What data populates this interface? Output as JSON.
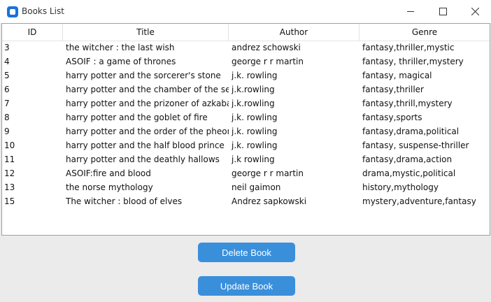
{
  "window": {
    "title": "Books List",
    "controls": {
      "minimize": "minimize-icon",
      "maximize": "maximize-icon",
      "close": "close-icon"
    }
  },
  "table": {
    "columns": [
      "ID",
      "Title",
      "Author",
      "Genre"
    ],
    "rows": [
      {
        "id": "3",
        "title": "the witcher : the last wish",
        "author": "andrez schowski",
        "genre": "fantasy,thriller,mystic"
      },
      {
        "id": "4",
        "title": "ASOIF : a game of thrones",
        "author": "george r r martin",
        "genre": "fantasy, thriller,mystery"
      },
      {
        "id": "5",
        "title": "harry potter and the sorcerer's stone",
        "author": "j.k. rowling",
        "genre": "fantasy,  magical"
      },
      {
        "id": "6",
        "title": "harry potter and the chamber of the secrets",
        "author": "j.k.rowling",
        "genre": "fantasy,thriller"
      },
      {
        "id": "7",
        "title": "harry potter and the prizoner of azkaban",
        "author": "j.k.rowling",
        "genre": "fantasy,thrill,mystery"
      },
      {
        "id": "8",
        "title": "harry potter and the goblet of fire",
        "author": "j.k. rowling",
        "genre": "fantasy,sports"
      },
      {
        "id": "9",
        "title": "harry potter and the order of the pheonix",
        "author": "j.k. rowling",
        "genre": "fantasy,drama,political"
      },
      {
        "id": "10",
        "title": "harry potter and the half blood prince",
        "author": "j.k. rowling",
        "genre": "fantasy, suspense-thriller"
      },
      {
        "id": "11",
        "title": "harry potter and the deathly hallows",
        "author": "j.k rowling",
        "genre": "fantasy,drama,action"
      },
      {
        "id": "12",
        "title": "ASOIF:fire and blood",
        "author": "george r r martin",
        "genre": "drama,mystic,political"
      },
      {
        "id": "13",
        "title": "the norse mythology",
        "author": "neil gaimon",
        "genre": "history,mythology"
      },
      {
        "id": "15",
        "title": "The witcher : blood of elves",
        "author": "Andrez sapkowski",
        "genre": "mystery,adventure,fantasy"
      }
    ]
  },
  "buttons": {
    "delete_label": "Delete Book",
    "update_label": "Update Book"
  },
  "colors": {
    "accent": "#3a8fdb",
    "app_icon": "#1a73d9"
  }
}
